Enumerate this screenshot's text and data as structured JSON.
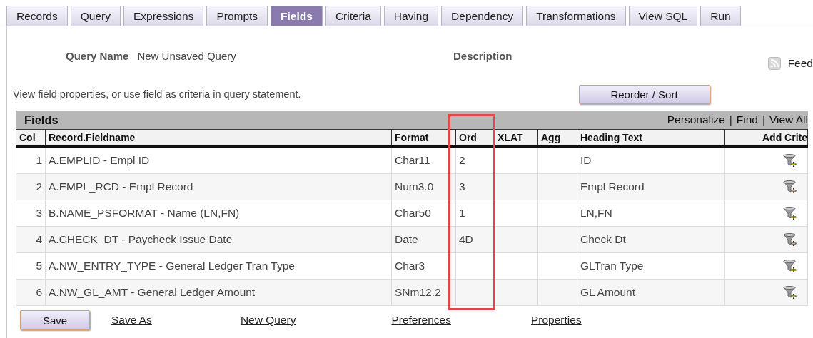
{
  "tabs": [
    {
      "label": "Records",
      "selected": false
    },
    {
      "label": "Query",
      "selected": false
    },
    {
      "label": "Expressions",
      "selected": false
    },
    {
      "label": "Prompts",
      "selected": false
    },
    {
      "label": "Fields",
      "selected": true
    },
    {
      "label": "Criteria",
      "selected": false
    },
    {
      "label": "Having",
      "selected": false
    },
    {
      "label": "Dependency",
      "selected": false
    },
    {
      "label": "Transformations",
      "selected": false
    },
    {
      "label": "View SQL",
      "selected": false
    },
    {
      "label": "Run",
      "selected": false
    }
  ],
  "query_name": {
    "label": "Query Name",
    "value": "New Unsaved Query"
  },
  "description": {
    "label": "Description"
  },
  "feed_link": "Feed",
  "instructions": "View field properties, or use field as criteria in query statement.",
  "reorder_button": "Reorder / Sort",
  "grid": {
    "title": "Fields",
    "links": [
      "Personalize",
      "Find",
      "View All"
    ],
    "separator": "|",
    "columns": [
      "Col",
      "Record.Fieldname",
      "Format",
      "Ord",
      "XLAT",
      "Agg",
      "Heading Text",
      "Add Crite"
    ],
    "rows": [
      {
        "col": "1",
        "fieldname": "A.EMPLID - Empl ID",
        "format": "Char11",
        "ord": "2",
        "heading": "ID"
      },
      {
        "col": "2",
        "fieldname": "A.EMPL_RCD - Empl Record",
        "format": "Num3.0",
        "ord": "3",
        "heading": "Empl Record"
      },
      {
        "col": "3",
        "fieldname": "B.NAME_PSFORMAT - Name (LN,FN)",
        "format": "Char50",
        "ord": "1",
        "heading": "LN,FN"
      },
      {
        "col": "4",
        "fieldname": "A.CHECK_DT - Paycheck Issue Date",
        "format": "Date",
        "ord": "4D",
        "heading": "Check Dt"
      },
      {
        "col": "5",
        "fieldname": "A.NW_ENTRY_TYPE - General Ledger Tran Type",
        "format": "Char3",
        "heading": "GLTran Type"
      },
      {
        "col": "6",
        "fieldname": "A.NW_GL_AMT - General Ledger Amount",
        "format": "SNm12.2",
        "heading": "GL Amount"
      }
    ]
  },
  "footer": {
    "save_button": "Save",
    "links": [
      "Save As",
      "New Query",
      "Preferences",
      "Properties"
    ]
  }
}
